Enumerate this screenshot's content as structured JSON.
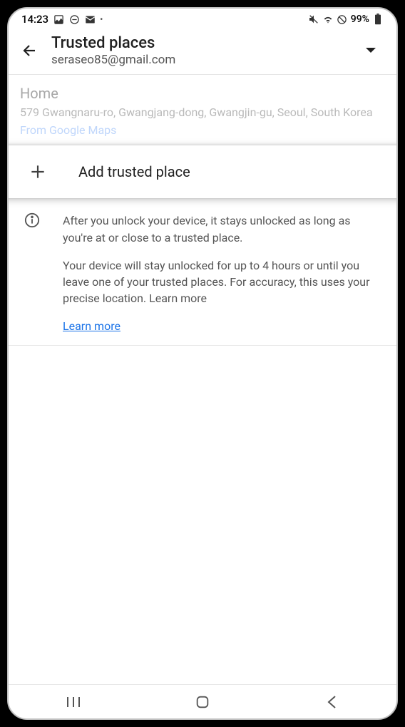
{
  "status": {
    "time": "14:23",
    "battery": "99%"
  },
  "header": {
    "title": "Trusted places",
    "subtitle": "seraseo85@gmail.com"
  },
  "place": {
    "name": "Home",
    "address": "579 Gwangnaru-ro, Gwangjang-dong, Gwangjin-gu, Seoul, South Korea",
    "source": "From Google Maps"
  },
  "add_place": {
    "label": "Add trusted place"
  },
  "info": {
    "para1": "After you unlock your device, it stays unlocked as long as you're at or close to a trusted place.",
    "para2": "Your device will stay unlocked for up to 4 hours or until you leave one of your trusted places. For accuracy, this uses your precise location. Learn more",
    "learn_more": "Learn more"
  }
}
